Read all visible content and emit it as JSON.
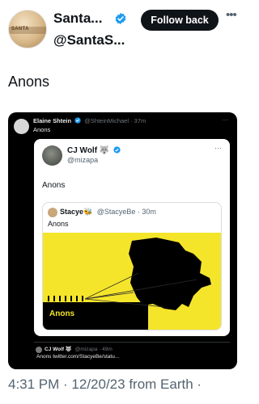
{
  "header": {
    "display_name": "Santa...",
    "handle": "@SantaS...",
    "follow_label": "Follow back",
    "more_label": "•••",
    "avatar_text": "SANTA"
  },
  "tweet": {
    "text": "Anons",
    "timestamp": "4:31 PM · 12/20/23 from Earth ·"
  },
  "media": {
    "author_name": "Elaine Shtein",
    "author_meta": "@ShteinMichael · 37m",
    "text": "Anons",
    "more_label": "···",
    "card": {
      "name": "CJ Wolf 🐺",
      "handle": "@mizapa",
      "text": "Anons",
      "more_label": "···",
      "quote": {
        "name": "Stacye🐝",
        "meta": "@StacyeBe · 30m",
        "text": "Anons",
        "image_label": "Anons"
      }
    },
    "footer": {
      "name": "CJ Wolf 🐺",
      "meta": "@mizapa · 49m",
      "text": "Anons twitter.com/StacyeBe/statu..."
    }
  },
  "colors": {
    "accent_blue": "#1d9bf0",
    "meme_yellow": "#f5e52a",
    "dark_bg": "#000000"
  }
}
